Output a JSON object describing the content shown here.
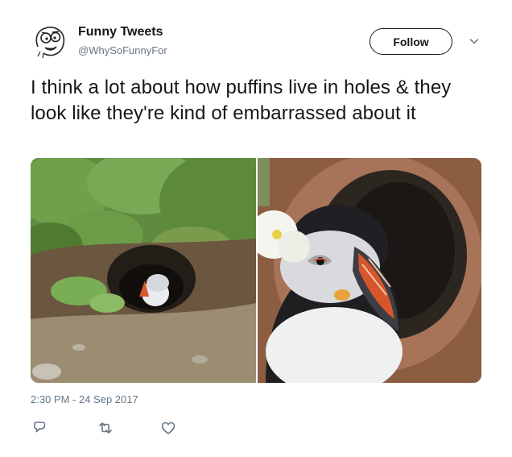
{
  "tweet": {
    "author_name": "Funny Tweets",
    "author_handle": "@WhySoFunnyFor",
    "follow_label": "Follow",
    "text": "I think a lot about how puffins live in holes & they look like they're kind of embarrassed about it",
    "timestamp": "2:30 PM - 24 Sep 2017",
    "media": [
      {
        "description_icon": "puffin-photo"
      },
      {
        "description_icon": "puffin-photo"
      }
    ]
  },
  "icons": {
    "avatar": "rage-face-avatar",
    "menu": "chevron-down-icon",
    "reply": "reply-icon",
    "retweet": "retweet-icon",
    "like": "heart-icon"
  },
  "colors": {
    "text": "#14171a",
    "secondary": "#657786",
    "action_icon": "#657786"
  }
}
